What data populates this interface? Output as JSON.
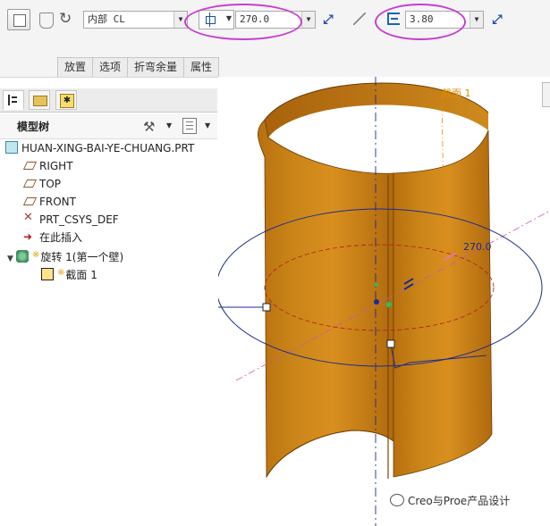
{
  "dashboard": {
    "side_select": "内部 CL",
    "angle_value": "270.0",
    "thickness_value": "3.80",
    "tabs": [
      "放置",
      "选项",
      "折弯余量",
      "属性"
    ]
  },
  "navigator": {
    "panel_title": "模型树",
    "tree": [
      {
        "label": "HUAN-XING-BAI-YE-CHUANG.PRT",
        "icon": "part-icon"
      },
      {
        "label": "RIGHT",
        "icon": "datum-plane-icon"
      },
      {
        "label": "TOP",
        "icon": "datum-plane-icon"
      },
      {
        "label": "FRONT",
        "icon": "datum-plane-icon"
      },
      {
        "label": "PRT_CSYS_DEF",
        "icon": "coordinate-system-icon"
      },
      {
        "label": "在此插入",
        "icon": "insert-here-arrow-icon"
      },
      {
        "label": "旋转 1(第一个壁)",
        "icon": "revolve-feature-icon"
      },
      {
        "label": "截面 1",
        "icon": "sketch-icon"
      }
    ]
  },
  "graphics": {
    "datum_label": "截面 1",
    "angle_dimension": "270.0"
  },
  "watermark": "Creo与Proe产品设计",
  "colors": {
    "wall": "#c27a12",
    "wall_highlight": "#e09a2c",
    "highlight_ring": "#c63fd0",
    "dimension": "#1c2c8a"
  }
}
